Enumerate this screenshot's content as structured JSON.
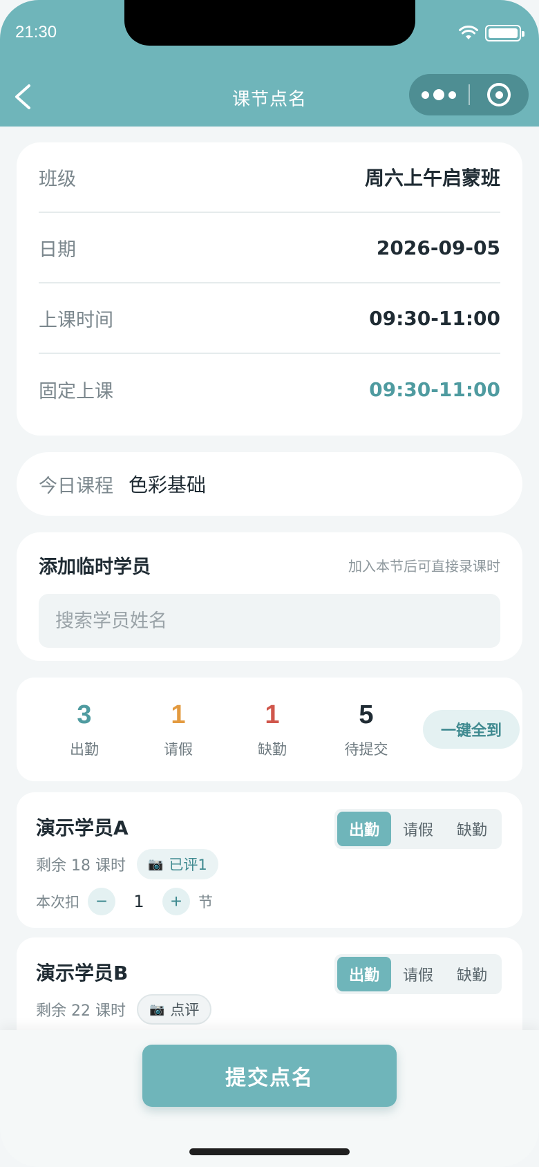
{
  "status_bar": {
    "time": "21:30"
  },
  "nav": {
    "title": "课节点名"
  },
  "class_info": [
    {
      "label": "班级",
      "value": "周六上午启蒙班"
    },
    {
      "label": "日期",
      "value": "2026-09-05"
    },
    {
      "label": "上课时间",
      "value": "09:30-11:00"
    },
    {
      "label": "固定上课",
      "value": "09:30-11:00"
    }
  ],
  "course": {
    "label": "今日课程",
    "value": "色彩基础"
  },
  "add_temp": {
    "title": "添加临时学员",
    "hint": "加入本节后可直接录课时",
    "placeholder": "搜索学员姓名"
  },
  "stats": {
    "items": [
      {
        "value": "3",
        "label": "出勤",
        "color": "#4f9ba0"
      },
      {
        "value": "1",
        "label": "请假",
        "color": "#e39a3f"
      },
      {
        "value": "1",
        "label": "缺勤",
        "color": "#d0564b"
      },
      {
        "value": "5",
        "label": "待提交",
        "color": "#1f2b33"
      }
    ],
    "all_present": "一键全到"
  },
  "students": [
    {
      "name": "演示学员A",
      "remain": "剩余 18 课时",
      "review": "已评1",
      "deduct_label": "本次扣",
      "deduct_value": "1",
      "unit": "节",
      "options": [
        "出勤",
        "请假",
        "缺勤"
      ],
      "selected": "出勤"
    },
    {
      "name": "演示学员B",
      "remain": "剩余 22 课时",
      "review": "点评",
      "options": [
        "出勤",
        "请假",
        "缺勤"
      ],
      "selected": "出勤"
    }
  ],
  "submit": "提交点名",
  "colors": {
    "brand": "#6fb5ba",
    "brand_dark": "#4e8e93"
  }
}
